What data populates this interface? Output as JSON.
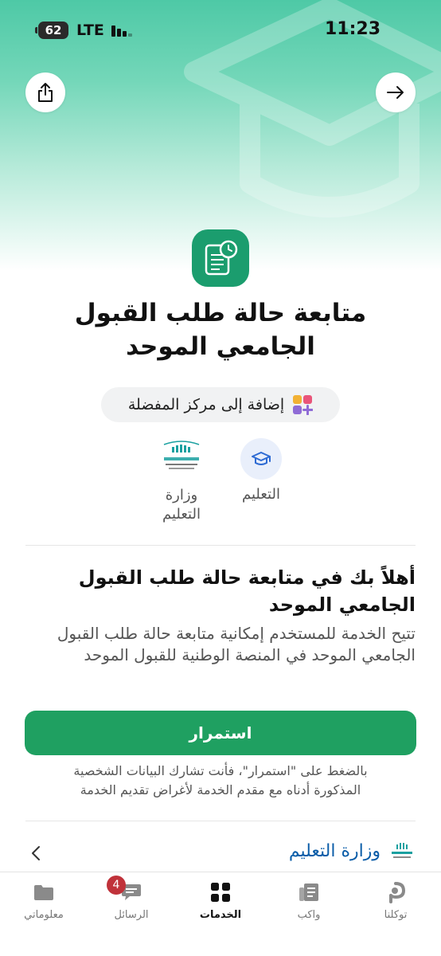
{
  "status_bar": {
    "battery": "62",
    "network": "LTE",
    "time": "11:23"
  },
  "service": {
    "title_line1": "متابعة حالة طلب القبول",
    "title_line2": "الجامعي الموحد"
  },
  "favorite": {
    "label": "إضافة إلى مركز المفضلة"
  },
  "category": {
    "label": "التعليم",
    "icon": "graduation-cap-icon"
  },
  "ministry": {
    "label_line1": "وزارة",
    "label_line2": "التعليم",
    "logo_text": "وزارة التعليم"
  },
  "welcome": {
    "heading_line1": "أهلاً بك في متابعة حالة طلب القبول",
    "heading_line2": "الجامعي الموحد",
    "description": "تتيح الخدمة للمستخدم إمكانية متابعة حالة طلب القبول الجامعي الموحد في المنصة الوطنية للقبول الموحد"
  },
  "continue_button": {
    "label": "استمرار",
    "color": "#1fa061"
  },
  "consent": {
    "line1": "بالضغط على \"استمرار\"، فأنت تشارك البيانات الشخصية",
    "line2": "المذكورة أدناه مع مقدم الخدمة لأغراض تقديم الخدمة"
  },
  "provider": {
    "name": "وزارة التعليم"
  },
  "tabbar": {
    "items": [
      {
        "label": "معلوماتي",
        "icon": "folder-icon"
      },
      {
        "label": "الرسائل",
        "icon": "chat-icon",
        "badge": "4"
      },
      {
        "label": "الخدمات",
        "icon": "grid-icon",
        "active": true
      },
      {
        "label": "واكب",
        "icon": "news-icon"
      },
      {
        "label": "توكلنا",
        "icon": "tawakkalna-logo-icon"
      }
    ]
  },
  "colors": {
    "accent": "#1fa061",
    "app_icon": "#1b9d6e",
    "link": "#0b5da8",
    "badge": "#c0323a"
  }
}
